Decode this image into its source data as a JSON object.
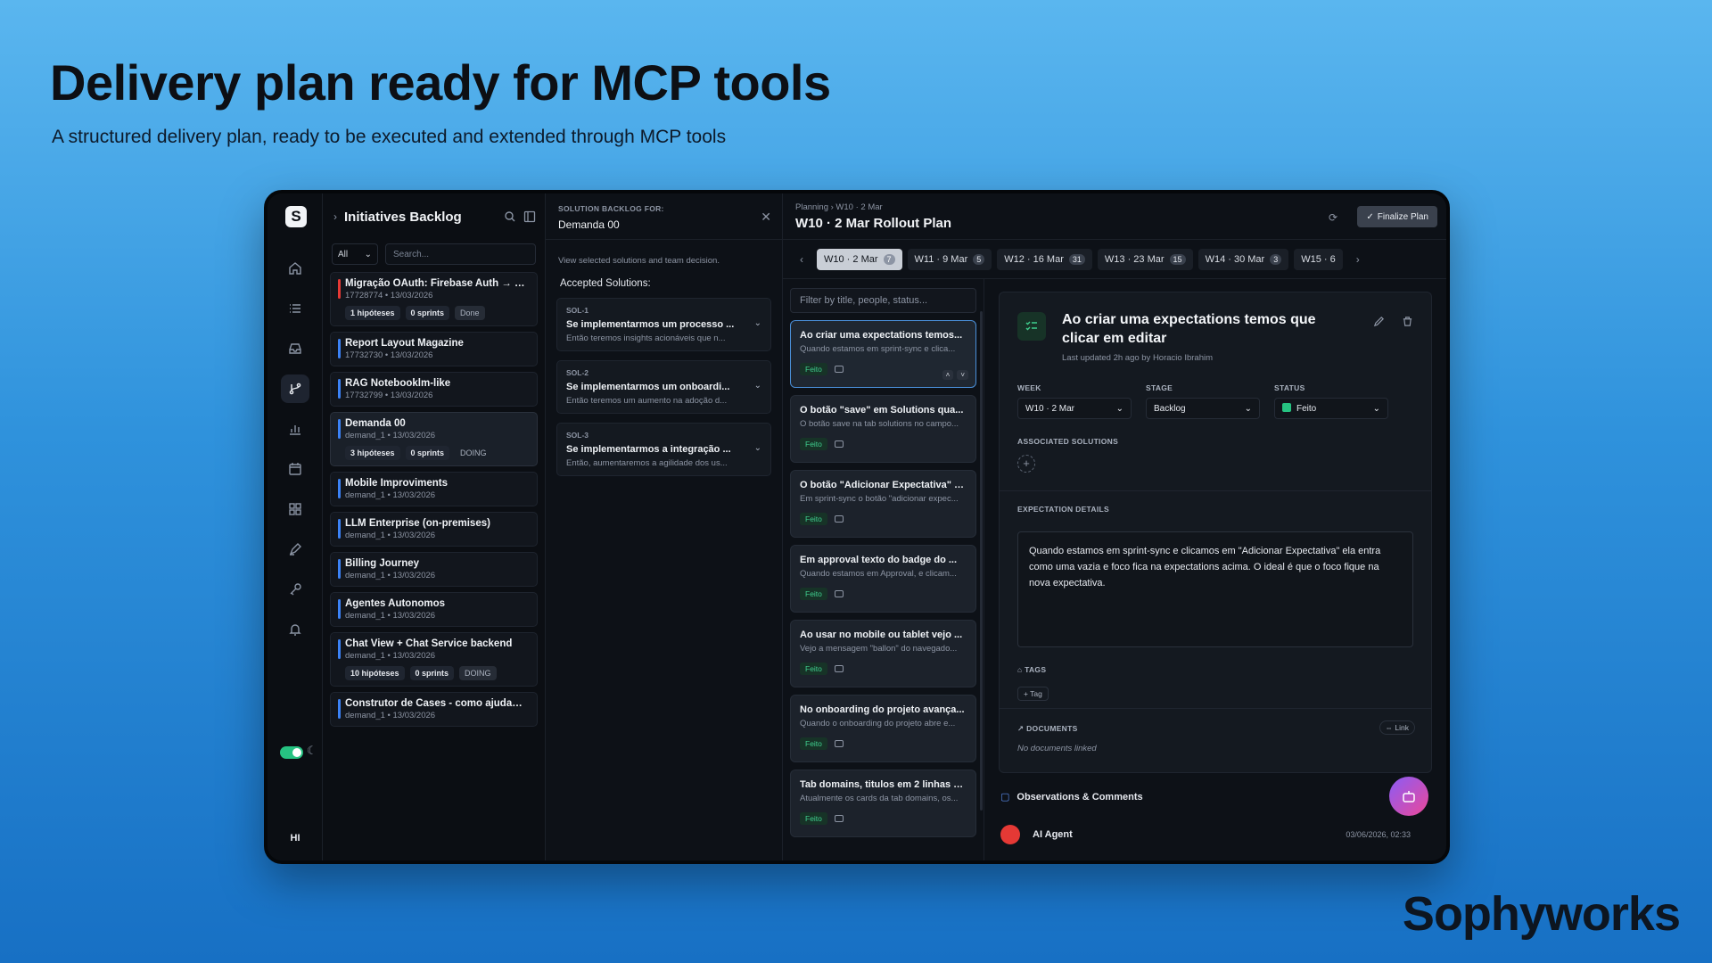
{
  "hero": {
    "title": "Delivery plan ready for MCP tools",
    "subtitle": "A structured delivery plan, ready to be executed and extended through MCP tools"
  },
  "brand": "Sophyworks",
  "rail": {
    "logo": "S",
    "user_initials": "HI"
  },
  "initiatives": {
    "title": "Initiatives Backlog",
    "filter_value": "All",
    "search_placeholder": "Search...",
    "items": [
      {
        "name": "Migração OAuth: Firebase Auth → G...",
        "meta": "17728774 • 13/03/2026",
        "hypotheses": "1 hipóteses",
        "sprints": "0 sprints",
        "status": "Done",
        "bar": "#e53935"
      },
      {
        "name": "Report Layout Magazine",
        "meta": "17732730 • 13/03/2026",
        "bar": "#3b82f6"
      },
      {
        "name": "RAG Notebooklm-like",
        "meta": "17732799 • 13/03/2026",
        "bar": "#3b82f6"
      },
      {
        "name": "Demanda 00",
        "meta": "demand_1 • 13/03/2026",
        "hypotheses": "3 hipóteses",
        "sprints": "0 sprints",
        "status": "DOING",
        "bar": "#3b82f6"
      },
      {
        "name": "Mobile Improviments",
        "meta": "demand_1 • 13/03/2026",
        "bar": "#3b82f6"
      },
      {
        "name": "LLM Enterprise (on-premises)",
        "meta": "demand_1 • 13/03/2026",
        "bar": "#3b82f6"
      },
      {
        "name": "Billing Journey",
        "meta": "demand_1 • 13/03/2026",
        "bar": "#3b82f6"
      },
      {
        "name": "Agentes Autonomos",
        "meta": "demand_1 • 13/03/2026",
        "bar": "#3b82f6"
      },
      {
        "name": "Chat View + Chat Service backend",
        "meta": "demand_1 • 13/03/2026",
        "hypotheses": "10 hipóteses",
        "sprints": "0 sprints",
        "status": "DOING",
        "bar": "#3b82f6"
      },
      {
        "name": "Construtor de Cases - como ajudam...",
        "meta": "demand_1 • 13/03/2026",
        "bar": "#3b82f6"
      }
    ]
  },
  "solutions": {
    "label": "SOLUTION BACKLOG FOR:",
    "demand": "Demanda 00",
    "hint": "View selected solutions and team decision.",
    "accepted_label": "Accepted Solutions:",
    "items": [
      {
        "id": "SOL-1",
        "title": "Se implementarmos um processo ...",
        "desc": "Então teremos insights acionáveis que n..."
      },
      {
        "id": "SOL-2",
        "title": "Se implementarmos um onboardi...",
        "desc": "Então teremos um aumento na adoção d..."
      },
      {
        "id": "SOL-3",
        "title": "Se implementarmos a integração ...",
        "desc": "Então, aumentaremos a agilidade dos us..."
      }
    ]
  },
  "plan": {
    "breadcrumb": "Planning › W10 · 2 Mar",
    "title": "W10 · 2 Mar Rollout Plan",
    "finalize_label": "Finalize Plan",
    "weeks": [
      {
        "label": "W10 · 2 Mar",
        "count": "7"
      },
      {
        "label": "W11 · 9 Mar",
        "count": "5"
      },
      {
        "label": "W12 · 16 Mar",
        "count": "31"
      },
      {
        "label": "W13 · 23 Mar",
        "count": "15"
      },
      {
        "label": "W14 · 30 Mar",
        "count": "3"
      },
      {
        "label": "W15 · 6",
        "count": ""
      }
    ],
    "filter_placeholder": "Filter by title, people, status...",
    "expectations": [
      {
        "title": "Ao criar uma expectations temos...",
        "desc": "Quando estamos em sprint-sync e clica...",
        "status": "Feito"
      },
      {
        "title": "O botão \"save\" em Solutions qua...",
        "desc": "O botão save na tab solutions no campo...",
        "status": "Feito"
      },
      {
        "title": "O botão \"Adicionar Expectativa\" e...",
        "desc": "Em sprint-sync o botão \"adicionar expec...",
        "status": "Feito"
      },
      {
        "title": "Em approval texto do badge do ...",
        "desc": "Quando estamos em Approval, e clicam...",
        "status": "Feito"
      },
      {
        "title": "Ao usar no mobile ou tablet vejo ...",
        "desc": "Vejo a mensagem \"ballon\" do navegado...",
        "status": "Feito"
      },
      {
        "title": "No onboarding do projeto avança...",
        "desc": "Quando o onboarding do projeto abre e...",
        "status": "Feito"
      },
      {
        "title": "Tab domains, titulos em 2 linhas s...",
        "desc": "Atualmente os cards da tab domains, os...",
        "status": "Feito"
      }
    ]
  },
  "detail": {
    "title": "Ao criar uma expectations temos que clicar em editar",
    "updated": "Last updated 2h ago by Horacio Ibrahim",
    "week_label": "WEEK",
    "week_value": "W10 · 2 Mar",
    "stage_label": "STAGE",
    "stage_value": "Backlog",
    "status_label": "STATUS",
    "status_value": "Feito",
    "assoc_label": "ASSOCIATED SOLUTIONS",
    "details_label": "EXPECTATION DETAILS",
    "details_text": "Quando estamos em sprint-sync e clicamos em \"Adicionar Expectativa\" ela entra como uma vazia e foco fica na expectations acima. O ideal é que o foco fique na nova expectativa.",
    "tags_label": "TAGS",
    "tag_button": "+ Tag",
    "documents_label": "DOCUMENTS",
    "link_button": "Link",
    "no_documents": "No documents linked",
    "observations": "Observations & Comments",
    "agent_name": "AI Agent",
    "agent_date": "03/06/2026, 02:33"
  }
}
